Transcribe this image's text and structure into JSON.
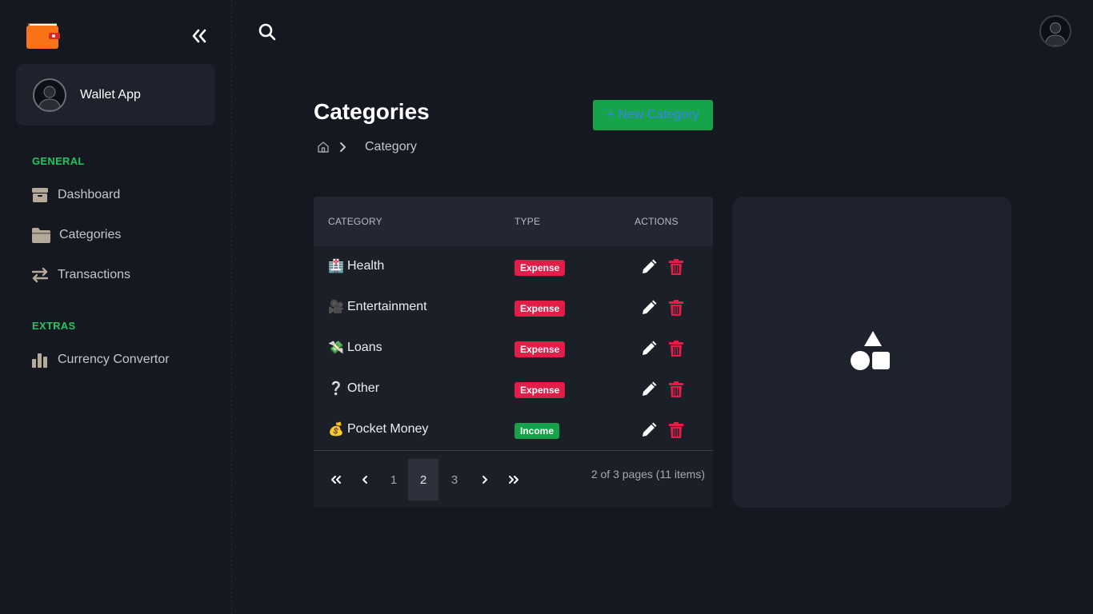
{
  "sidebar": {
    "logo_icon": "wallet-icon",
    "collapse_icon": "double-chevron-left-icon",
    "profile": {
      "name": "Wallet App",
      "avatar_icon": "user-avatar-icon"
    },
    "sections": [
      {
        "label": "GENERAL",
        "items": [
          {
            "label": "Dashboard",
            "icon": "box-icon"
          },
          {
            "label": "Categories",
            "icon": "folder-icon"
          },
          {
            "label": "Transactions",
            "icon": "arrows-exchange-icon"
          }
        ]
      },
      {
        "label": "EXTRAS",
        "items": [
          {
            "label": "Currency Convertor",
            "icon": "bar-chart-icon"
          }
        ]
      }
    ]
  },
  "topbar": {
    "search_icon": "search-icon",
    "avatar_icon": "user-avatar-icon"
  },
  "page": {
    "title": "Categories",
    "new_button_label": "+ New Category",
    "breadcrumb": {
      "home_icon": "home-icon",
      "current": "Category"
    }
  },
  "table": {
    "columns": [
      "CATEGORY",
      "TYPE",
      "ACTIONS"
    ],
    "rows": [
      {
        "emoji": "🏥",
        "name": "Health",
        "type": "Expense"
      },
      {
        "emoji": "🎥",
        "name": "Entertainment",
        "type": "Expense"
      },
      {
        "emoji": "💸",
        "name": "Loans",
        "type": "Expense"
      },
      {
        "emoji": "❔",
        "name": "Other",
        "type": "Expense"
      },
      {
        "emoji": "💰",
        "name": "Pocket Money",
        "type": "Income"
      }
    ],
    "pagination": {
      "first": "«",
      "prev": "‹",
      "pages": [
        "1",
        "2",
        "3"
      ],
      "current_page": "2",
      "next": "›",
      "last": "»",
      "info": "2 of 3 pages (11 items)"
    }
  },
  "side_card": {
    "icon": "shapes-icon"
  },
  "colors": {
    "accent_green": "#22c55e",
    "button_green": "#16a34a",
    "expense_red": "#e11d48",
    "background": "#151821"
  }
}
